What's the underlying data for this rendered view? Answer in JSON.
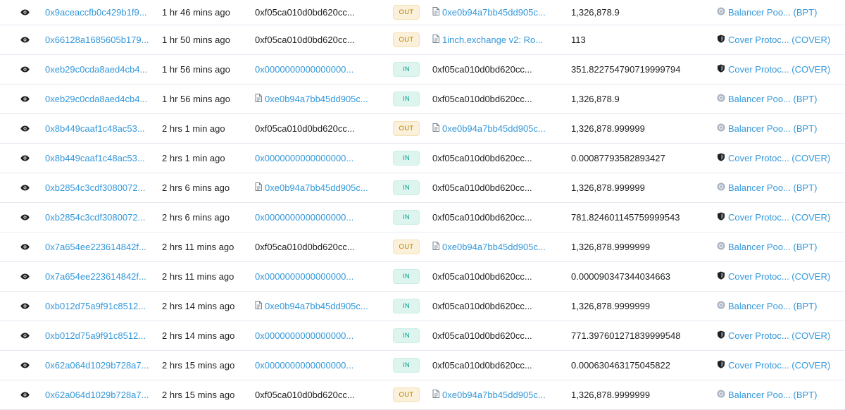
{
  "table": {
    "rows": [
      {
        "hash": "0x9aceaccfb0c429b1f9...",
        "age": "1 hr 46 mins ago",
        "from": "0xf05ca010d0bd620cc...",
        "from_link": false,
        "from_contract": false,
        "direction": "OUT",
        "to": "0xe0b94a7bb45dd905c...",
        "to_link": true,
        "to_contract": true,
        "value": "1,326,878.9",
        "token": "Balancer Poo... (BPT)",
        "token_icon": "balancer-icon"
      },
      {
        "hash": "0x66128a1685605b179...",
        "age": "1 hr 50 mins ago",
        "from": "0xf05ca010d0bd620cc...",
        "from_link": false,
        "from_contract": false,
        "direction": "OUT",
        "to": "1inch.exchange v2: Ro...",
        "to_link": true,
        "to_contract": true,
        "value": "113",
        "token": "Cover Protoc... (COVER)",
        "token_icon": "cover-shield-icon"
      },
      {
        "hash": "0xeb29c0cda8aed4cb4...",
        "age": "1 hr 56 mins ago",
        "from": "0x0000000000000000...",
        "from_link": true,
        "from_contract": false,
        "direction": "IN",
        "to": "0xf05ca010d0bd620cc...",
        "to_link": false,
        "to_contract": false,
        "value": "351.822754790719999794",
        "token": "Cover Protoc... (COVER)",
        "token_icon": "cover-shield-icon"
      },
      {
        "hash": "0xeb29c0cda8aed4cb4...",
        "age": "1 hr 56 mins ago",
        "from": "0xe0b94a7bb45dd905c...",
        "from_link": true,
        "from_contract": true,
        "direction": "IN",
        "to": "0xf05ca010d0bd620cc...",
        "to_link": false,
        "to_contract": false,
        "value": "1,326,878.9",
        "token": "Balancer Poo... (BPT)",
        "token_icon": "balancer-icon"
      },
      {
        "hash": "0x8b449caaf1c48ac53...",
        "age": "2 hrs 1 min ago",
        "from": "0xf05ca010d0bd620cc...",
        "from_link": false,
        "from_contract": false,
        "direction": "OUT",
        "to": "0xe0b94a7bb45dd905c...",
        "to_link": true,
        "to_contract": true,
        "value": "1,326,878.999999",
        "token": "Balancer Poo... (BPT)",
        "token_icon": "balancer-icon"
      },
      {
        "hash": "0x8b449caaf1c48ac53...",
        "age": "2 hrs 1 min ago",
        "from": "0x0000000000000000...",
        "from_link": true,
        "from_contract": false,
        "direction": "IN",
        "to": "0xf05ca010d0bd620cc...",
        "to_link": false,
        "to_contract": false,
        "value": "0.00087793582893427",
        "token": "Cover Protoc... (COVER)",
        "token_icon": "cover-shield-icon"
      },
      {
        "hash": "0xb2854c3cdf3080072...",
        "age": "2 hrs 6 mins ago",
        "from": "0xe0b94a7bb45dd905c...",
        "from_link": true,
        "from_contract": true,
        "direction": "IN",
        "to": "0xf05ca010d0bd620cc...",
        "to_link": false,
        "to_contract": false,
        "value": "1,326,878.999999",
        "token": "Balancer Poo... (BPT)",
        "token_icon": "balancer-icon"
      },
      {
        "hash": "0xb2854c3cdf3080072...",
        "age": "2 hrs 6 mins ago",
        "from": "0x0000000000000000...",
        "from_link": true,
        "from_contract": false,
        "direction": "IN",
        "to": "0xf05ca010d0bd620cc...",
        "to_link": false,
        "to_contract": false,
        "value": "781.824601145759999543",
        "token": "Cover Protoc... (COVER)",
        "token_icon": "cover-shield-icon"
      },
      {
        "hash": "0x7a654ee223614842f...",
        "age": "2 hrs 11 mins ago",
        "from": "0xf05ca010d0bd620cc...",
        "from_link": false,
        "from_contract": false,
        "direction": "OUT",
        "to": "0xe0b94a7bb45dd905c...",
        "to_link": true,
        "to_contract": true,
        "value": "1,326,878.9999999",
        "token": "Balancer Poo... (BPT)",
        "token_icon": "balancer-icon"
      },
      {
        "hash": "0x7a654ee223614842f...",
        "age": "2 hrs 11 mins ago",
        "from": "0x0000000000000000...",
        "from_link": true,
        "from_contract": false,
        "direction": "IN",
        "to": "0xf05ca010d0bd620cc...",
        "to_link": false,
        "to_contract": false,
        "value": "0.000090347344034663",
        "token": "Cover Protoc... (COVER)",
        "token_icon": "cover-shield-icon"
      },
      {
        "hash": "0xb012d75a9f91c8512...",
        "age": "2 hrs 14 mins ago",
        "from": "0xe0b94a7bb45dd905c...",
        "from_link": true,
        "from_contract": true,
        "direction": "IN",
        "to": "0xf05ca010d0bd620cc...",
        "to_link": false,
        "to_contract": false,
        "value": "1,326,878.9999999",
        "token": "Balancer Poo... (BPT)",
        "token_icon": "balancer-icon"
      },
      {
        "hash": "0xb012d75a9f91c8512...",
        "age": "2 hrs 14 mins ago",
        "from": "0x0000000000000000...",
        "from_link": true,
        "from_contract": false,
        "direction": "IN",
        "to": "0xf05ca010d0bd620cc...",
        "to_link": false,
        "to_contract": false,
        "value": "771.397601271839999548",
        "token": "Cover Protoc... (COVER)",
        "token_icon": "cover-shield-icon"
      },
      {
        "hash": "0x62a064d1029b728a7...",
        "age": "2 hrs 15 mins ago",
        "from": "0x0000000000000000...",
        "from_link": true,
        "from_contract": false,
        "direction": "IN",
        "to": "0xf05ca010d0bd620cc...",
        "to_link": false,
        "to_contract": false,
        "value": "0.000630463175045822",
        "token": "Cover Protoc... (COVER)",
        "token_icon": "cover-shield-icon"
      },
      {
        "hash": "0x62a064d1029b728a7...",
        "age": "2 hrs 15 mins ago",
        "from": "0xf05ca010d0bd620cc...",
        "from_link": false,
        "from_contract": false,
        "direction": "OUT",
        "to": "0xe0b94a7bb45dd905c...",
        "to_link": true,
        "to_contract": true,
        "value": "1,326,878.9999999",
        "token": "Balancer Poo... (BPT)",
        "token_icon": "balancer-icon"
      }
    ]
  },
  "colors": {
    "link": "#3498db",
    "text": "#1e2022",
    "out_bg": "#fbf0d9",
    "out_text": "#b47d00",
    "in_bg": "#def5ef",
    "in_text": "#00a186"
  }
}
